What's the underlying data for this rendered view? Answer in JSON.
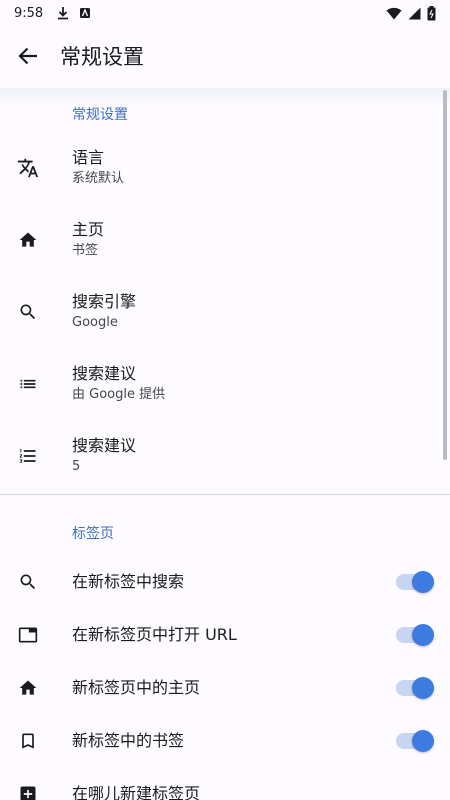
{
  "status_bar": {
    "time": "9:58"
  },
  "app_bar": {
    "title": "常规设置"
  },
  "sections": {
    "general": {
      "header": "常规设置",
      "items": [
        {
          "title": "语言",
          "summary": "系统默认"
        },
        {
          "title": "主页",
          "summary": "书签"
        },
        {
          "title": "搜索引擎",
          "summary": "Google"
        },
        {
          "title": "搜索建议",
          "summary": "由 Google 提供"
        },
        {
          "title": "搜索建议",
          "summary": "5"
        }
      ]
    },
    "tabs": {
      "header": "标签页",
      "items": [
        {
          "title": "在新标签中搜索",
          "switch": true
        },
        {
          "title": "在新标签页中打开 URL",
          "switch": true
        },
        {
          "title": "新标签页中的主页",
          "switch": true
        },
        {
          "title": "新标签中的书签",
          "switch": true
        },
        {
          "title": "在哪儿新建标签页"
        }
      ]
    }
  },
  "colors": {
    "accent": "#3d7be0",
    "section_header": "#3e6fc6",
    "switch_track": "#c7d5f2"
  },
  "icons": [
    "translate-icon",
    "home-icon",
    "search-icon",
    "list-icon",
    "numbered-list-icon",
    "search-icon",
    "tab-icon",
    "home-icon",
    "bookmark-icon",
    "add-tab-icon"
  ]
}
